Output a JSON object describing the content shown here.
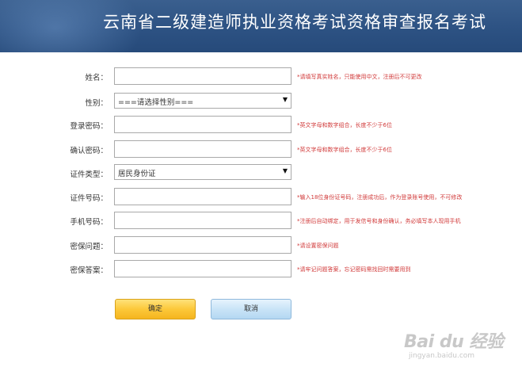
{
  "banner": {
    "title": "云南省二级建造师执业资格考试资格审查报名考试"
  },
  "form": {
    "rows": [
      {
        "label": "姓名：",
        "value": "",
        "hint": "*请填写真实姓名，只能使用中文，注册后不可更改"
      },
      {
        "label": "性别：",
        "value": "===请选择性别===",
        "hint": ""
      },
      {
        "label": "登录密码：",
        "value": "",
        "hint": "*英文字母和数字组合，长度不少于6位"
      },
      {
        "label": "确认密码：",
        "value": "",
        "hint": "*英文字母和数字组合，长度不少于6位"
      },
      {
        "label": "证件类型：",
        "value": "居民身份证",
        "hint": ""
      },
      {
        "label": "证件号码：",
        "value": "",
        "hint": "*输入18位身份证号码，注册成功后，作为登录账号使用，不可修改"
      },
      {
        "label": "手机号码：",
        "value": "",
        "hint": "*注册后自动绑定，用于发信号和身份确认，务必填写本人现用手机"
      },
      {
        "label": "密保问题：",
        "value": "",
        "hint": "*请设置密保问题"
      },
      {
        "label": "密保答案：",
        "value": "",
        "hint": "*请牢记问题答案，忘记密码需找回时需要用到"
      }
    ],
    "buttons": {
      "ok": "确定",
      "cancel": "取消"
    }
  },
  "watermark": {
    "logo": "Bai du 经验",
    "url": "jingyan.baidu.com"
  },
  "icons": {
    "dropdown": "triangle-down-icon"
  },
  "colors": {
    "banner": "#2d5283",
    "hint": "#d13a3a",
    "ok_button": "#fcc83a",
    "cancel_button": "#c9e4f7"
  }
}
